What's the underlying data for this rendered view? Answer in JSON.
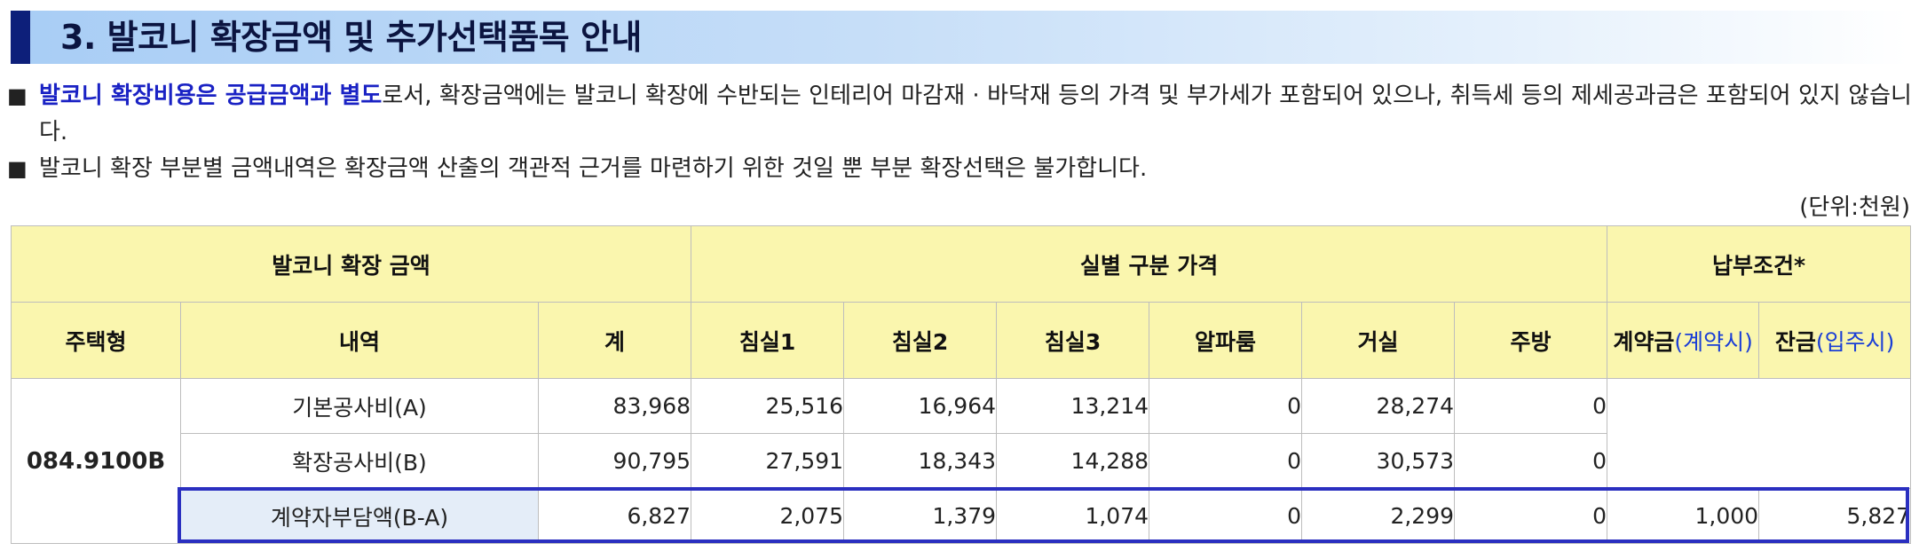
{
  "section": {
    "title": "3. 발코니 확장금액 및 추가선택품목 안내"
  },
  "notes": [
    {
      "bullet": "■",
      "highlight": "발코니 확장비용은 공급금액과 별도",
      "text": "로서, 확장금액에는 발코니 확장에 수반되는 인테리어 마감재 · 바닥재 등의 가격 및 부가세가 포함되어 있으나, 취득세 등의 제세공과금은 포함되어 있지 않습니다."
    },
    {
      "bullet": "■",
      "text": "발코니 확장 부분별 금액내역은 확장금액 산출의 객관적 근거를 마련하기 위한 것일 뿐 부분 확장선택은 불가합니다."
    }
  ],
  "unit": "(단위:천원)",
  "table": {
    "group_headers": {
      "expansion": "발코니 확장 금액",
      "rooms": "실별 구분 가격",
      "payment": "납부조건*"
    },
    "columns": {
      "type": "주택형",
      "item": "내역",
      "total": "계",
      "bed1": "침실1",
      "bed2": "침실2",
      "bed3": "침실3",
      "alpha": "알파룸",
      "living": "거실",
      "kitchen": "주방",
      "deposit_main": "계약금",
      "deposit_sub": "(계약시)",
      "balance_main": "잔금",
      "balance_sub": "(입주시)"
    },
    "house_type": "084.9100B",
    "rows": [
      {
        "label": "기본공사비(A)",
        "total": "83,968",
        "bed1": "25,516",
        "bed2": "16,964",
        "bed3": "13,214",
        "alpha": "0",
        "living": "28,274",
        "kitchen": "0"
      },
      {
        "label": "확장공사비(B)",
        "total": "90,795",
        "bed1": "27,591",
        "bed2": "18,343",
        "bed3": "14,288",
        "alpha": "0",
        "living": "30,573",
        "kitchen": "0"
      },
      {
        "label": "계약자부담액(B-A)",
        "total": "6,827",
        "bed1": "2,075",
        "bed2": "1,379",
        "bed3": "1,074",
        "alpha": "0",
        "living": "2,299",
        "kitchen": "0",
        "deposit": "1,000",
        "balance": "5,827"
      }
    ]
  }
}
